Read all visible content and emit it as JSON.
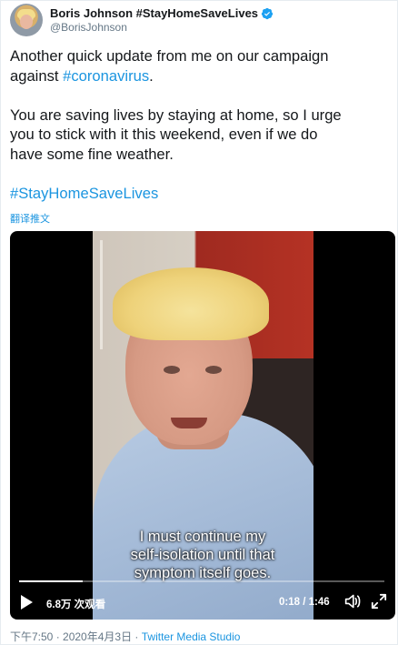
{
  "author": {
    "display_name": "Boris Johnson #StayHomeSaveLives",
    "handle": "@BorisJohnson",
    "verified_icon": "verified-badge-icon",
    "verified_color": "#1da1f2"
  },
  "tweet": {
    "line1": "Another quick update from me on our campaign",
    "line2_prefix": "against ",
    "line2_hashtag": "#coronavirus",
    "line2_suffix": ".",
    "line3": "You are saving lives by staying at home, so I urge",
    "line4": "you to stick with it this weekend, even if we do",
    "line5": "have some fine weather.",
    "hashtag_line": "#StayHomeSaveLives",
    "translate_label": "翻译推文"
  },
  "video": {
    "subtitle_lines": [
      "I must continue my",
      "self-isolation until that",
      "symptom itself goes."
    ],
    "views_label": "6.8万 次观看",
    "time_label": "0:18 / 1:46",
    "progress_fraction": 0.173,
    "play_icon": "play-icon",
    "volume_icon": "volume-icon",
    "fullscreen_icon": "fullscreen-icon"
  },
  "footer": {
    "timestamp": "下午7:50 · 2020年4月3日 · ",
    "source": "Twitter Media Studio"
  },
  "colors": {
    "link": "#1b95e0",
    "secondary_text": "#657786",
    "video_bg": "#000000"
  }
}
